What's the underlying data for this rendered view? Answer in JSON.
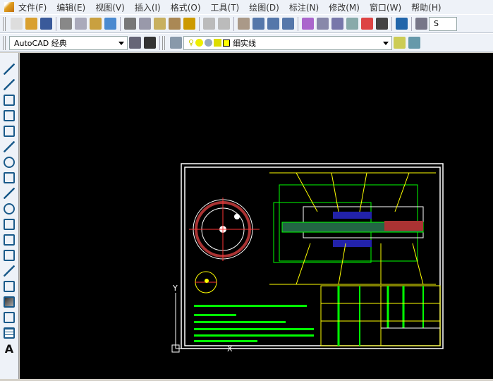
{
  "menu": [
    "文件(F)",
    "编辑(E)",
    "视图(V)",
    "插入(I)",
    "格式(O)",
    "工具(T)",
    "绘图(D)",
    "标注(N)",
    "修改(M)",
    "窗口(W)",
    "帮助(H)"
  ],
  "toolbar1": {
    "icons": [
      "new-icon",
      "open-icon",
      "save-icon",
      "print-icon",
      "print-preview-icon",
      "publish-icon",
      "web-icon",
      "cut-icon",
      "copy-icon",
      "paste-icon",
      "match-properties-icon",
      "block-editor-icon",
      "undo-icon",
      "redo-icon",
      "pan-icon",
      "zoom-realtime-icon",
      "zoom-window-icon",
      "zoom-previous-icon",
      "properties-icon",
      "design-center-icon",
      "tool-palettes-icon",
      "sheet-set-icon",
      "markup-icon",
      "calculator-icon",
      "help-icon"
    ],
    "text_style_value": "S"
  },
  "toolbar2": {
    "workspace_value": "AutoCAD 经典",
    "layer_value": "细实线"
  },
  "left_toolbar": {
    "icons": [
      "line-icon",
      "construction-line-icon",
      "polyline-icon",
      "polygon-icon",
      "rectangle-icon",
      "arc-icon",
      "circle-icon",
      "revision-cloud-icon",
      "spline-icon",
      "ellipse-icon",
      "ellipse-arc-icon",
      "insert-block-icon",
      "make-block-icon",
      "point-icon",
      "hatch-icon",
      "gradient-icon",
      "region-icon",
      "table-icon"
    ],
    "mtext_label": "A"
  },
  "colors": {
    "canvas": "#000000",
    "drawing_green": "#00ff00",
    "drawing_yellow": "#ffff00",
    "drawing_white": "#ffffff"
  },
  "ucs": {
    "y_label": "Y",
    "x_label": "X"
  }
}
